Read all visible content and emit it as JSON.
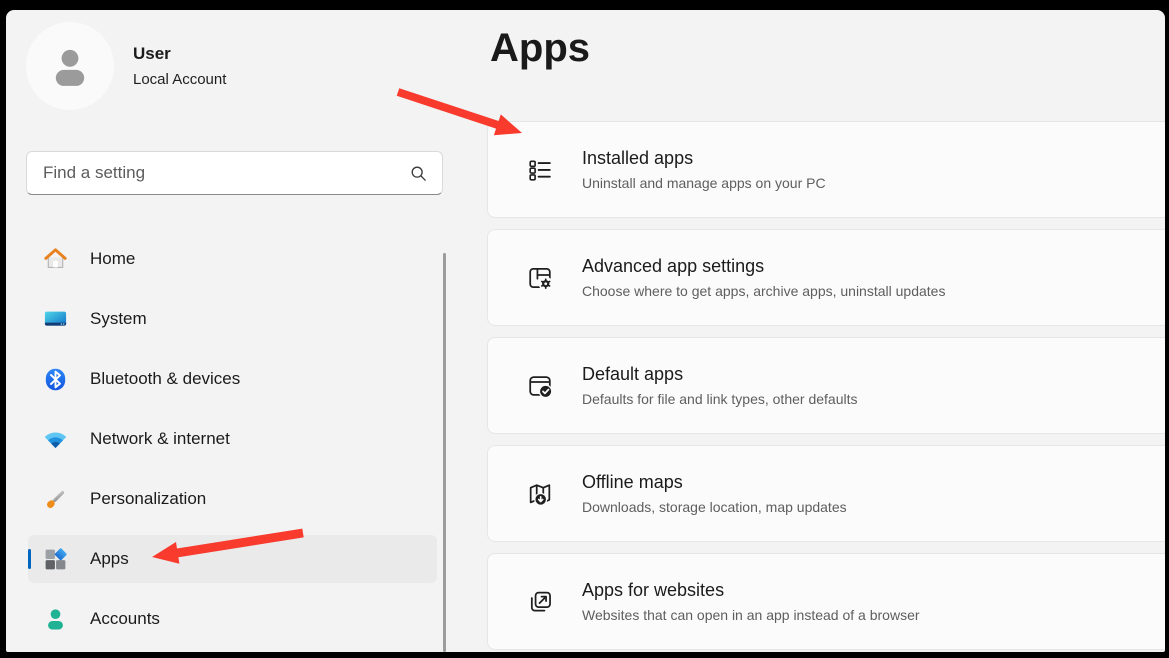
{
  "account": {
    "name": "User",
    "type": "Local Account"
  },
  "search": {
    "placeholder": "Find a setting"
  },
  "sidebar": {
    "items": [
      {
        "label": "Home",
        "selected": false
      },
      {
        "label": "System",
        "selected": false
      },
      {
        "label": "Bluetooth & devices",
        "selected": false
      },
      {
        "label": "Network & internet",
        "selected": false
      },
      {
        "label": "Personalization",
        "selected": false
      },
      {
        "label": "Apps",
        "selected": true
      },
      {
        "label": "Accounts",
        "selected": false
      }
    ]
  },
  "main": {
    "title": "Apps",
    "cards": [
      {
        "title": "Installed apps",
        "subtitle": "Uninstall and manage apps on your PC"
      },
      {
        "title": "Advanced app settings",
        "subtitle": "Choose where to get apps, archive apps, uninstall updates"
      },
      {
        "title": "Default apps",
        "subtitle": "Defaults for file and link types, other defaults"
      },
      {
        "title": "Offline maps",
        "subtitle": "Downloads, storage location, map updates"
      },
      {
        "title": "Apps for websites",
        "subtitle": "Websites that can open in an app instead of a browser"
      }
    ]
  },
  "annotations": {
    "arrow_color": "#f93b2e",
    "arrows": [
      "points-to-installed-apps-card",
      "points-to-apps-sidebar-item"
    ]
  },
  "colors": {
    "accent": "#0067c0",
    "window_bg": "#f3f3f3",
    "card_bg": "#fbfbfb",
    "card_border": "#e6e6e6",
    "selected_item_bg": "#eaeaea",
    "frame": "#000000"
  }
}
